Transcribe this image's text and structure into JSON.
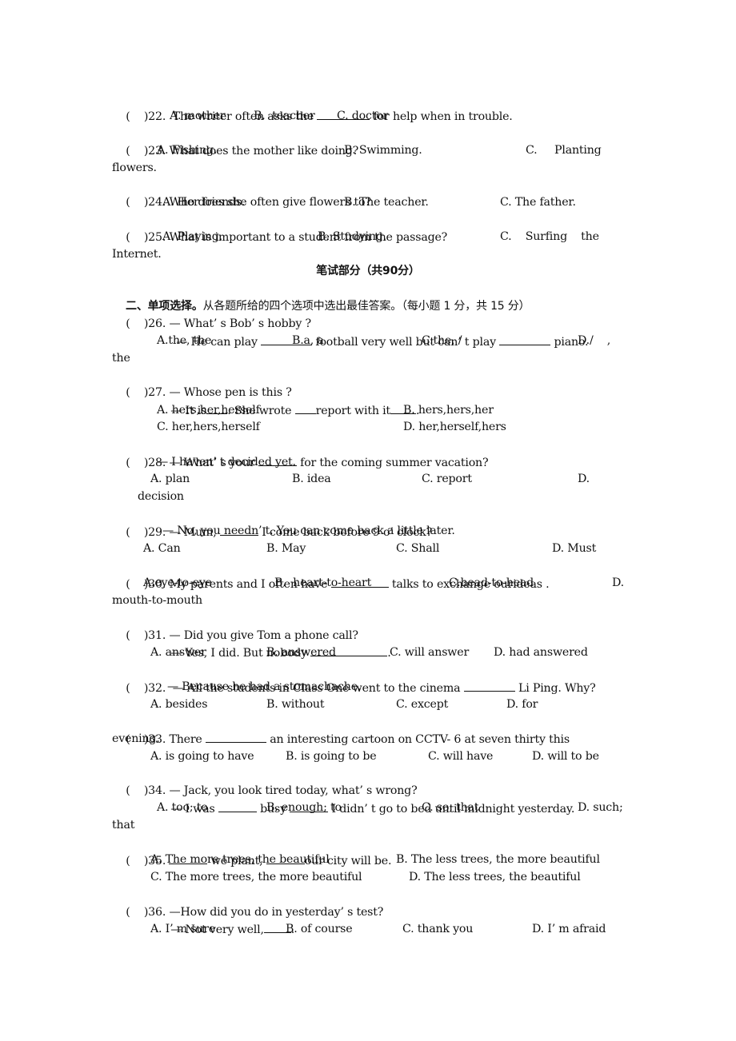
{
  "questions_top": [
    {
      "num": "22",
      "stem_pre": "The writer often asks the ",
      "stem_post": " for help when in trouble.",
      "options": [
        "A. mother",
        "B.  teacher",
        "C. doctor"
      ]
    },
    {
      "num": "23",
      "stem": "What does the mother like doing?",
      "options": [
        "A. Fishing.",
        "B. Swimming.",
        "C.     Planting"
      ],
      "wrap": "flowers."
    },
    {
      "num": "24",
      "stem": "Who does she often give flowers to?",
      "options": [
        "A. Her friends.",
        "B. The teacher.",
        "C. The father."
      ]
    },
    {
      "num": "25",
      "stem": "What is important to a student from the passage?",
      "options": [
        "A. Playing.",
        "B. Studying.",
        "C.    Surfing    the"
      ],
      "wrap": "Internet."
    }
  ],
  "written_heading": "笔试部分（共90分）",
  "section": {
    "title": "二、单项选择。",
    "instruction": "从各题所给的四个选项中选出最佳答案。（每小题 1 分，共 15 分）"
  },
  "bracket": "(    )",
  "q26": {
    "num": "26",
    "line1": "— What’ s Bob’ s hobby ?",
    "line2_a": "— He can play ",
    "line2_b": " football very well but can’ t play ",
    "line2_c": " piano.",
    "options": [
      "A.the, the",
      "B.a, a",
      "C.the, /",
      "D./    ,"
    ],
    "wrap": "the"
  },
  "q27": {
    "num": "27",
    "line1": "— Whose pen is this ?",
    "line2_a": "— It is",
    "line2_b": ". She wrote ",
    "line2_c": "report with it",
    "line2_d": ".",
    "options": [
      "A. hers,her,herself",
      "B. hers,hers,her",
      "C. her,hers,herself",
      "D. her,herself,hers"
    ]
  },
  "q28": {
    "num": "28",
    "line1_a": "— What’ s your ",
    "line1_b": " for the coming summer vacation?",
    "line2": "— I haven’ t decided yet.",
    "options": [
      "A. plan",
      "B. idea",
      "C. report",
      "D."
    ],
    "wrap": "decision"
  },
  "q29": {
    "num": "29",
    "line1_a": "— Mum, ",
    "line1_b": " I come back before 9 o’ clock?",
    "line2": "— No, you needn’ t. You can come back a little later.",
    "options": [
      "A. Can",
      "B. May",
      "C. Shall",
      "D. Must"
    ]
  },
  "q30": {
    "num": "30",
    "line1_a": "My parents and I often have ",
    "line1_b": " talks to exchange ourideas .",
    "options": [
      "A.eye-to-eye",
      "B.  heart-to-heart",
      "C.head-to-head",
      "D."
    ],
    "wrap": "mouth-to-mouth"
  },
  "q31": {
    "num": "31",
    "line1": "— Did you give Tom a phone call?",
    "line2_a": "— Yes, I did. But nobody ",
    "line2_b": ".",
    "options": [
      "A. answer",
      "B. answered",
      "C. will answer",
      "D. had answered"
    ]
  },
  "q32": {
    "num": "32",
    "line1_a": " — All the students in Class One went to the cinema ",
    "line1_b": " Li Ping. Why?",
    "line2": "— Because he had a stomachache.",
    "options": [
      "A. besides",
      "B. without",
      "C. except",
      "D. for"
    ]
  },
  "q33": {
    "num": "33",
    "line1_a": "There ",
    "line1_b": " an interesting cartoon on CCTV- 6 at seven thirty this",
    "wrap": "evening.",
    "options": [
      "A. is going to have",
      "B. is going to be",
      "C. will have",
      "D. will to be"
    ]
  },
  "q34": {
    "num": "34",
    "line1": "— Jack, you look tired today, what’ s wrong?",
    "line2_a": "— I was ",
    "line2_b": " busy ",
    "line2_c": " I didn’ t go to bed until midnight yesterday.",
    "options": [
      "A. too; to",
      "B. enough; to",
      "C. so; that",
      "D. such;"
    ],
    "wrap": "that"
  },
  "q35": {
    "num": "35",
    "line1_a": " ",
    "line1_b": " we plant, ",
    "line1_c": "our city will be.",
    "options": [
      "A. The more trees, the beautiful",
      "B. The less trees, the more beautiful",
      "C. The more trees, the more beautiful",
      "D. The less trees, the beautiful"
    ]
  },
  "q36": {
    "num": "36",
    "line1": "—How did you do in yesterday’ s test?",
    "line2_a": "— Not very well,",
    "line2_b": ".",
    "options": [
      "A. I’ m sure",
      "B. of course",
      "C. thank you",
      "D. I’ m afraid"
    ]
  }
}
